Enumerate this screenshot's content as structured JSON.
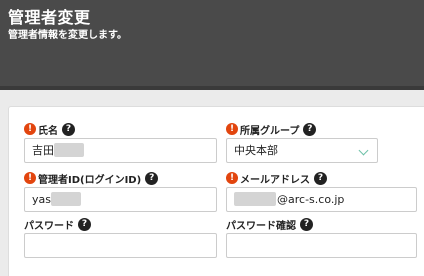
{
  "header": {
    "title": "管理者変更",
    "subtitle": "管理者情報を変更します。"
  },
  "fields": {
    "name": {
      "label": "氏名",
      "value_prefix": "吉田",
      "required": true
    },
    "group": {
      "label": "所属グループ",
      "value": "中央本部",
      "required": true
    },
    "admin_id": {
      "label": "管理者ID(ログインID)",
      "value_prefix": "yas",
      "required": true
    },
    "email": {
      "label": "メールアドレス",
      "value_suffix": "@arc-s.co.jp",
      "required": true
    },
    "password": {
      "label": "パスワード",
      "value": ""
    },
    "password_confirm": {
      "label": "パスワード確認",
      "value": ""
    }
  },
  "icons": {
    "required": "!",
    "help": "?"
  },
  "colors": {
    "header_bg": "#4a4a4a",
    "required": "#e2450e",
    "chevron": "#6ec1a8"
  }
}
